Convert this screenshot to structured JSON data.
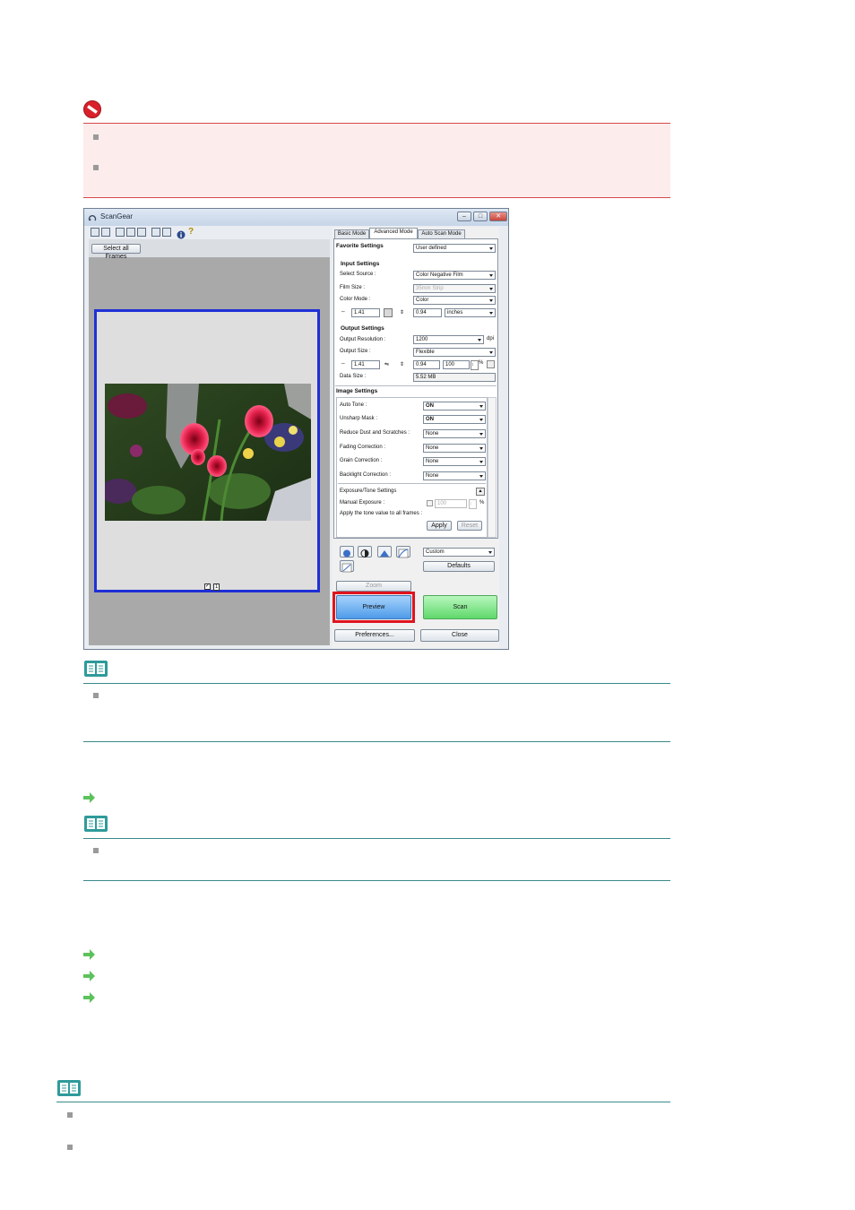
{
  "window": {
    "title": "ScanGear",
    "minimize": "–",
    "maximize": "□",
    "close": "✕"
  },
  "left": {
    "select_all_frames": "Select all Frames",
    "frame_number": "1"
  },
  "tabs": [
    {
      "label": "Basic Mode"
    },
    {
      "label": "Advanced Mode"
    },
    {
      "label": "Auto Scan Mode"
    }
  ],
  "favorite": {
    "label": "Favorite Settings",
    "value": "User defined"
  },
  "input_settings": {
    "heading": "Input Settings",
    "select_source_label": "Select Source :",
    "select_source_value": "Color Negative Film",
    "film_size_label": "Film Size :",
    "film_size_value": "35mm Strip",
    "color_mode_label": "Color Mode :",
    "color_mode_value": "Color",
    "width": "1.41",
    "height": "0.94",
    "unit": "inches"
  },
  "output_settings": {
    "heading": "Output Settings",
    "resolution_label": "Output Resolution :",
    "resolution_value": "1200",
    "resolution_unit": "dpi",
    "size_label": "Output Size :",
    "size_value": "Flexible",
    "width": "1.41",
    "height": "0.94",
    "scale": "100",
    "scale_unit": "%",
    "data_size_label": "Data Size :",
    "data_size_value": "5.52 MB"
  },
  "image_settings": {
    "heading": "Image Settings",
    "rows": [
      {
        "label": "Auto Tone :",
        "value": "ON"
      },
      {
        "label": "Unsharp Mask :",
        "value": "ON"
      },
      {
        "label": "Reduce Dust and Scratches :",
        "value": "None"
      },
      {
        "label": "Fading Correction :",
        "value": "None"
      },
      {
        "label": "Grain Correction :",
        "value": "None"
      },
      {
        "label": "Backlight Correction :",
        "value": "None"
      }
    ],
    "exposure_label": "Exposure/Tone Settings",
    "manual_exposure_label": "Manual Exposure :",
    "manual_exposure_value": "100",
    "manual_exposure_unit": "%",
    "apply_all_label": "Apply the tone value to all frames :",
    "apply_button": "Apply",
    "reset_button": "Reset"
  },
  "tone": {
    "preset_value": "Custom",
    "defaults_button": "Defaults"
  },
  "buttons": {
    "zoom": "Zoom",
    "preview": "Preview",
    "scan": "Scan",
    "preferences": "Preferences...",
    "close": "Close"
  },
  "colors": {
    "highlight_red": "#e0141e",
    "frame_blue": "#1f2fd6",
    "preview_blue": "#5aa3ec",
    "scan_green": "#6fe07a",
    "note_teal": "#3a8a8a",
    "arrow_green": "#5cc25c"
  }
}
